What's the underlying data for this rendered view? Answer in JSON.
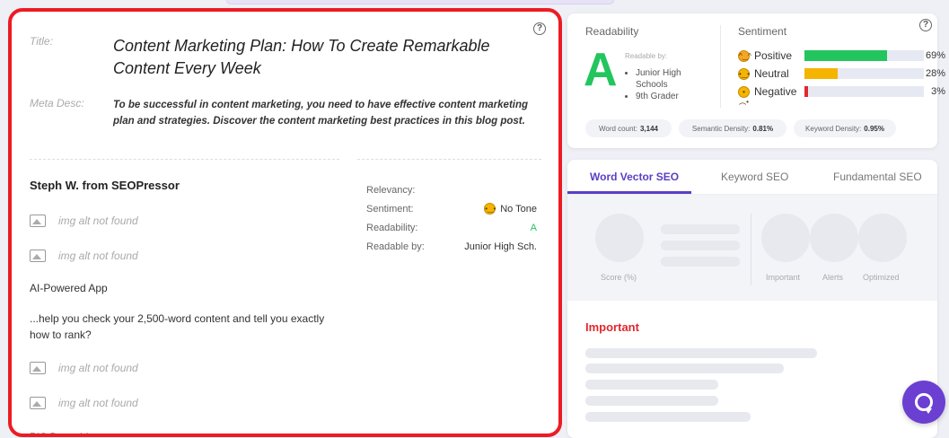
{
  "content": {
    "title_label": "Title:",
    "title": "Content Marketing Plan: How To Create Remarkable Content Every Week",
    "meta_label": "Meta Desc:",
    "meta_desc": "To be successful in content marketing, you need to have effective content marketing plan and strategies. Discover the content marketing best practices in this blog post.",
    "author": "Steph W. from SEOPressor",
    "img_alt_missing": "img alt not found",
    "ai_powered": "AI-Powered App",
    "help_text": "...help you check your 2,500-word content and tell you exactly how to rank?",
    "cut_text": "PIS Data-driven to..."
  },
  "analysis": {
    "relevancy_label": "Relevancy:",
    "sentiment_label": "Sentiment:",
    "sentiment_value": "No Tone",
    "readability_label": "Readability:",
    "readability_value": "A",
    "readable_by_label": "Readable by:",
    "readable_by_value": "Junior High Sch."
  },
  "readability": {
    "title": "Readability",
    "grade": "A",
    "readable_by_label": "Readable by:",
    "levels": [
      "Junior High Schools",
      "9th Grader"
    ]
  },
  "sentiment": {
    "title": "Sentiment",
    "rows": [
      {
        "label": "Positive",
        "pct": "69%",
        "value": 0.69,
        "color": "#22c55e"
      },
      {
        "label": "Neutral",
        "pct": "28%",
        "value": 0.28,
        "color": "#f5b400"
      },
      {
        "label": "Negative",
        "pct": "3%",
        "value": 0.03,
        "color": "#e0282e"
      }
    ]
  },
  "stats": {
    "word_count_label": "Word count:",
    "word_count": "3,144",
    "semantic_label": "Semantic Density:",
    "semantic": "0.81%",
    "keyword_label": "Keyword Density:",
    "keyword": "0.95%"
  },
  "tabs": [
    "Word Vector SEO",
    "Keyword SEO",
    "Fundamental SEO"
  ],
  "scores": {
    "score_label": "Score (%)",
    "important_label": "Important",
    "alerts_label": "Alerts",
    "optimized_label": "Optimized"
  },
  "important_heading": "Important",
  "help_icon": "?"
}
